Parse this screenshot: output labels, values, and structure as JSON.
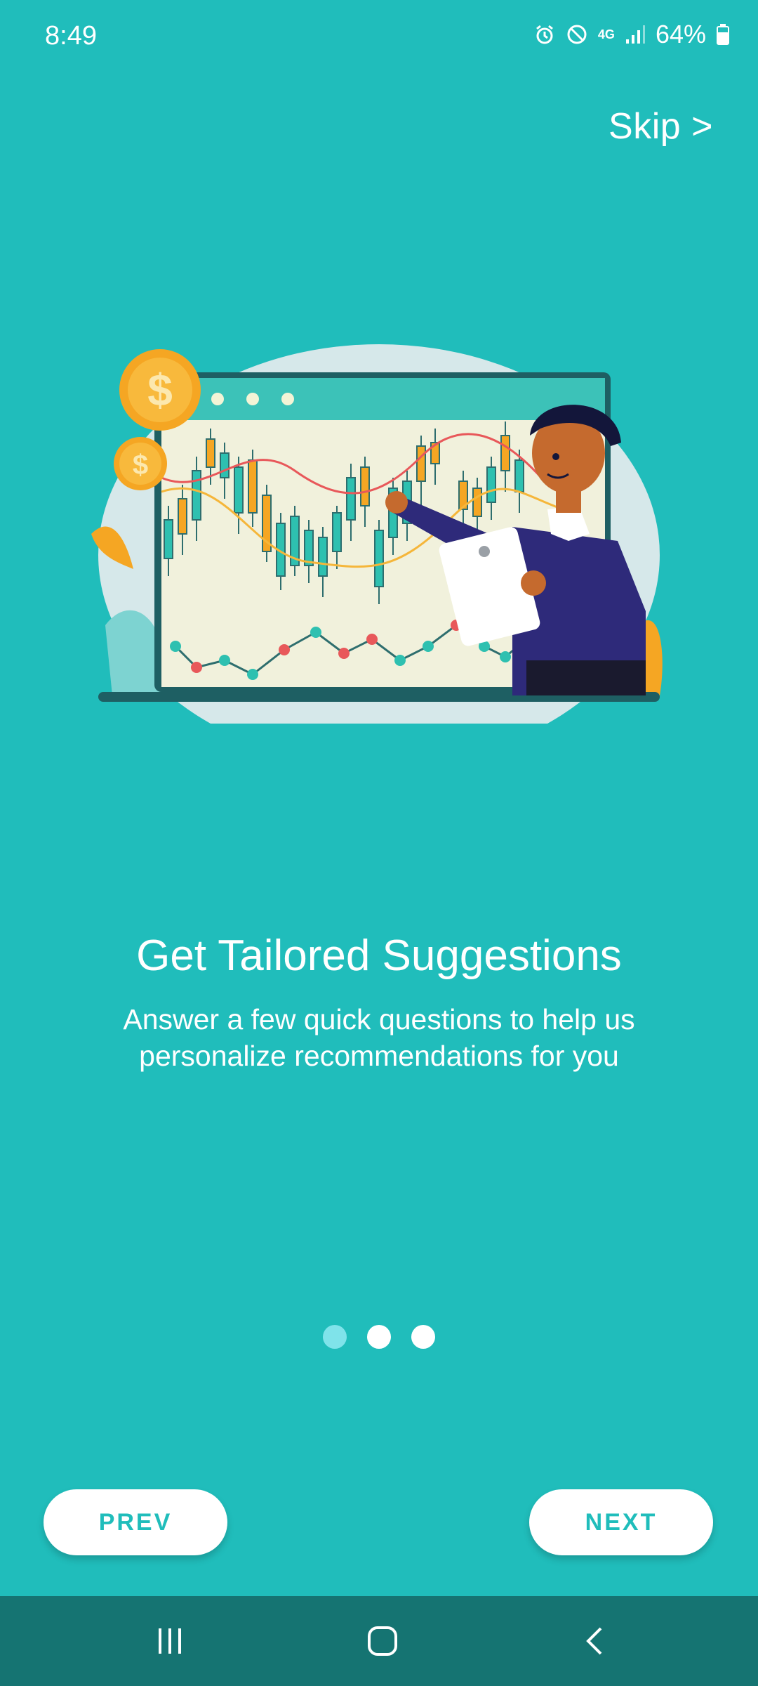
{
  "status_bar": {
    "time": "8:49",
    "network": "4G",
    "battery": "64%",
    "icons": [
      "alarm-icon",
      "do-not-disturb-icon",
      "network-4g-icon",
      "signal-icon",
      "battery-icon"
    ]
  },
  "skip_label": "Skip >",
  "onboarding": {
    "title": "Get Tailored Suggestions",
    "subtitle": "Answer a few quick questions to help us personalize recommendations for you",
    "page_index": 1,
    "page_count": 3
  },
  "buttons": {
    "prev_label": "PREV",
    "next_label": "NEXT"
  },
  "nav_bar": {
    "icons": [
      "recent-apps-icon",
      "home-icon",
      "back-icon"
    ]
  },
  "colors": {
    "background": "#20BDBB",
    "accent": "#20BDBB",
    "active_dot": "#7FE3EA",
    "nav_bar": "#157472"
  }
}
